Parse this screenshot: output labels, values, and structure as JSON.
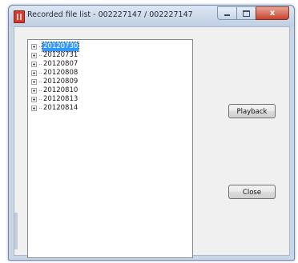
{
  "window": {
    "title": "Recorded file list - 002227147 / 002227147",
    "close_glyph": "x"
  },
  "tree": {
    "items": [
      {
        "label": "20120730",
        "selected": true
      },
      {
        "label": "20120731",
        "selected": false
      },
      {
        "label": "20120807",
        "selected": false
      },
      {
        "label": "20120808",
        "selected": false
      },
      {
        "label": "20120809",
        "selected": false
      },
      {
        "label": "20120810",
        "selected": false
      },
      {
        "label": "20120813",
        "selected": false
      },
      {
        "label": "20120814",
        "selected": false
      }
    ]
  },
  "buttons": {
    "playback_label": "Playback",
    "close_label": "Close"
  },
  "colors": {
    "selection": "#3399ff",
    "title_bar": "#c9d6e6",
    "close_button": "#c8442f"
  },
  "icons": {
    "app": "app-icon",
    "minimize": "minimize-icon",
    "maximize": "maximize-icon",
    "close": "close-icon",
    "expand": "plus-expander-icon"
  }
}
